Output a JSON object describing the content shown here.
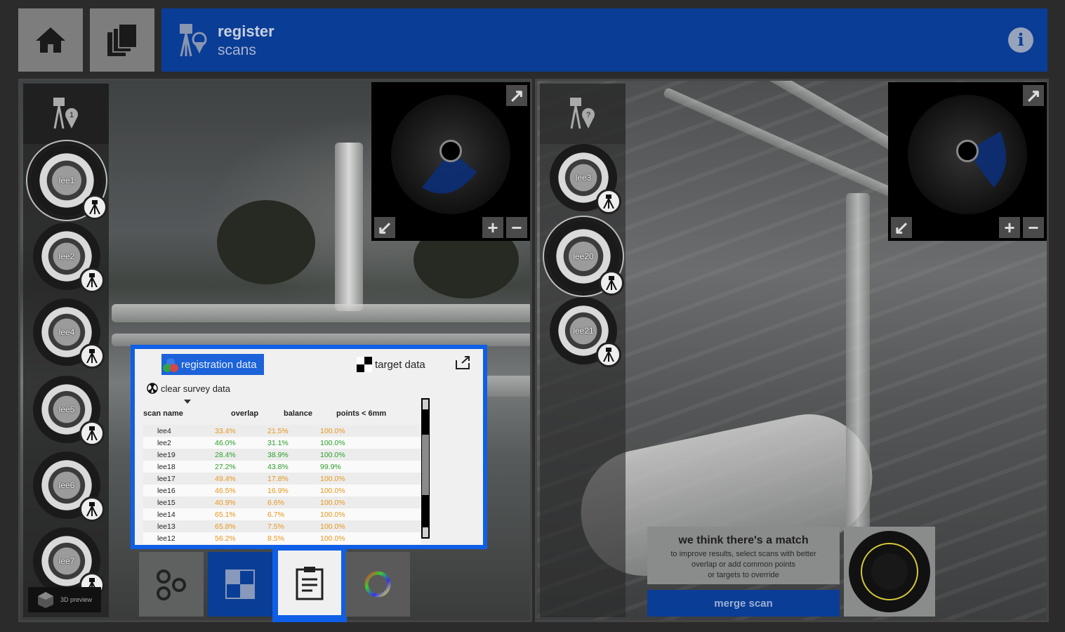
{
  "header": {
    "title_line1": "register",
    "title_line2": "scans",
    "info_glyph": "i",
    "home_icon": "home-icon",
    "pages_icon": "pages-icon",
    "info_icon": "info-icon"
  },
  "left_scans": [
    {
      "label": "lee1",
      "selected": true
    },
    {
      "label": "lee2",
      "selected": false
    },
    {
      "label": "lee4",
      "selected": false
    },
    {
      "label": "lee5",
      "selected": false
    },
    {
      "label": "lee6",
      "selected": false
    },
    {
      "label": "lee7",
      "selected": false
    }
  ],
  "right_scans": [
    {
      "label": "lee3",
      "selected": false
    },
    {
      "label": "lee20",
      "selected": true
    },
    {
      "label": "lee21",
      "selected": false
    }
  ],
  "left_strip_badge": "1",
  "right_strip_badge": "?",
  "preview_label": "3D preview",
  "popup": {
    "tab_registration": "registration data",
    "tab_target": "target data",
    "clear_label": "clear survey data",
    "columns": [
      "scan name",
      "overlap",
      "balance",
      "points < 6mm"
    ],
    "rows": [
      {
        "name": "lee4",
        "overlap": "33.4%",
        "balance": "21.5%",
        "points": "100.0%",
        "colors": [
          "orange",
          "orange",
          "orange"
        ]
      },
      {
        "name": "lee2",
        "overlap": "46.0%",
        "balance": "31.1%",
        "points": "100.0%",
        "colors": [
          "green",
          "green",
          "green"
        ]
      },
      {
        "name": "lee19",
        "overlap": "28.4%",
        "balance": "38.9%",
        "points": "100.0%",
        "colors": [
          "green",
          "green",
          "green"
        ]
      },
      {
        "name": "lee18",
        "overlap": "27.2%",
        "balance": "43.8%",
        "points": "99.9%",
        "colors": [
          "green",
          "green",
          "green"
        ]
      },
      {
        "name": "lee17",
        "overlap": "49.4%",
        "balance": "17.8%",
        "points": "100.0%",
        "colors": [
          "orange",
          "orange",
          "orange"
        ]
      },
      {
        "name": "lee16",
        "overlap": "46.5%",
        "balance": "16.9%",
        "points": "100.0%",
        "colors": [
          "orange",
          "orange",
          "orange"
        ]
      },
      {
        "name": "lee15",
        "overlap": "40.9%",
        "balance": "6.6%",
        "points": "100.0%",
        "colors": [
          "orange",
          "orange",
          "orange"
        ]
      },
      {
        "name": "lee14",
        "overlap": "65.1%",
        "balance": "6.7%",
        "points": "100.0%",
        "colors": [
          "orange",
          "orange",
          "orange"
        ]
      },
      {
        "name": "lee13",
        "overlap": "65.8%",
        "balance": "7.5%",
        "points": "100.0%",
        "colors": [
          "orange",
          "orange",
          "orange"
        ]
      },
      {
        "name": "lee12",
        "overlap": "56.2%",
        "balance": "8.5%",
        "points": "100.0%",
        "colors": [
          "orange",
          "orange",
          "orange"
        ]
      }
    ]
  },
  "match": {
    "heading": "we think there's a match",
    "line1": "to improve results, select scans with better",
    "line2": "overlap or add common points",
    "line3": "or targets to override",
    "merge_label": "merge scan"
  },
  "colors": {
    "accent_blue": "#0a3d96",
    "popup_border": "#0f5ee6",
    "warn": "#e8961a",
    "ok": "#2aa02a"
  }
}
